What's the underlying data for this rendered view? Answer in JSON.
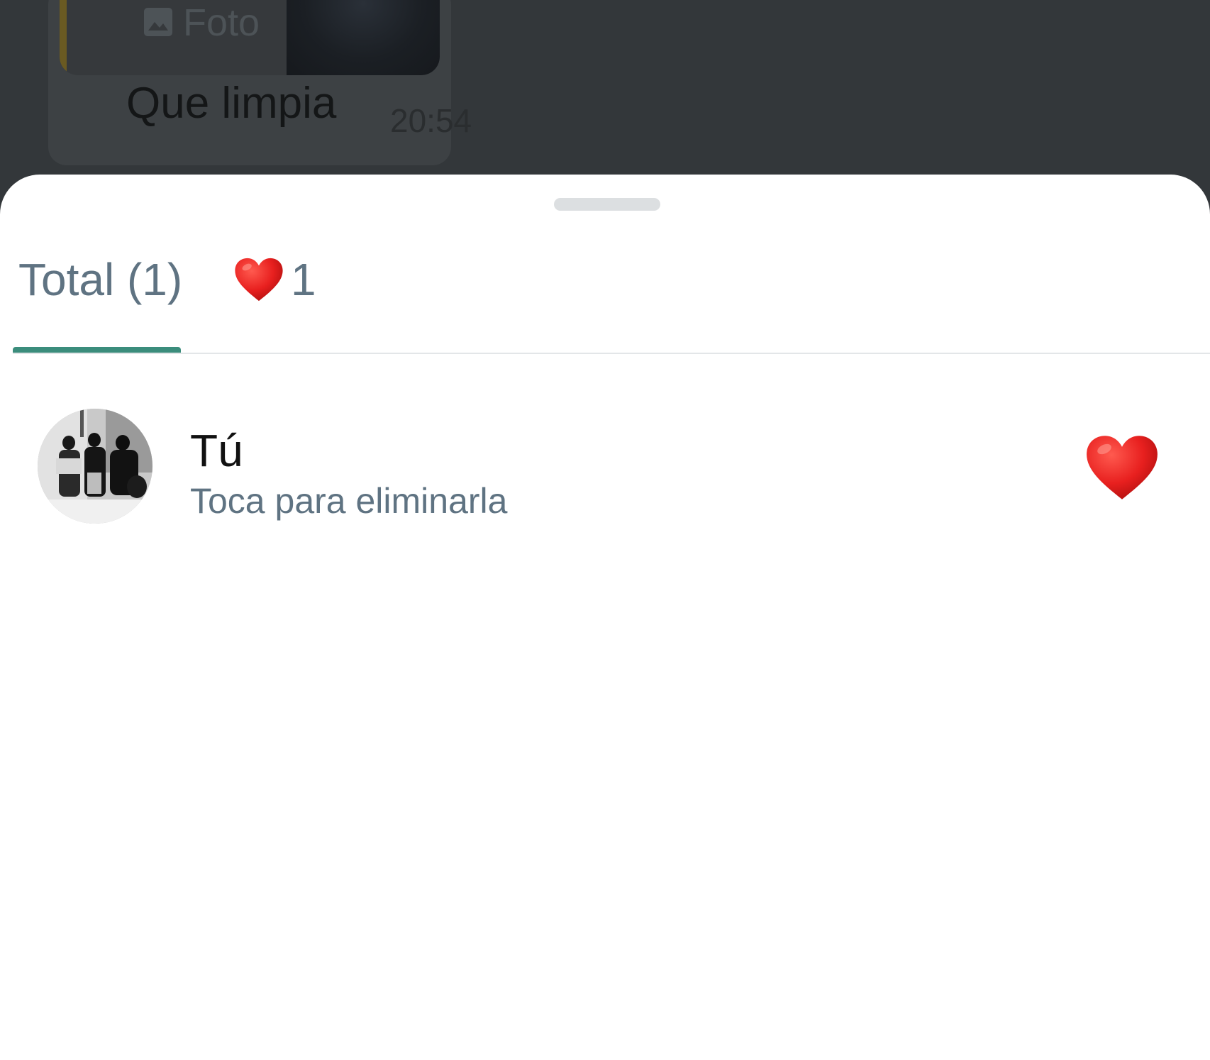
{
  "chat": {
    "quoted_label": "Foto",
    "message_text": "Que limpia",
    "message_time": "20:54"
  },
  "sheet": {
    "tabs": [
      {
        "label": "Total (1)",
        "selected": true
      },
      {
        "emoji": "❤️",
        "count": "1",
        "selected": false
      }
    ],
    "reactors": [
      {
        "name": "Tú",
        "subtitle": "Toca para eliminarla",
        "reaction": "❤️"
      }
    ]
  },
  "colors": {
    "accent": "#3b8d7c",
    "tab_text": "#5f7382",
    "heart": "#e8201f"
  },
  "icons": {
    "quoted_type": "photo-icon",
    "reaction": "heart-icon"
  }
}
